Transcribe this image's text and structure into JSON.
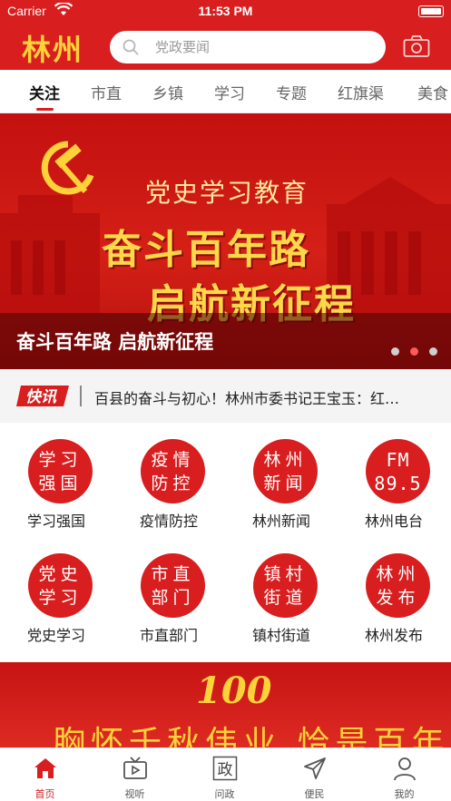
{
  "status": {
    "carrier": "Carrier",
    "time": "11:53 PM"
  },
  "header": {
    "logo_text": "林州",
    "search_placeholder": "党政要闻",
    "camera_icon": "camera-icon"
  },
  "tabs": [
    {
      "label": "关注",
      "active": true
    },
    {
      "label": "市直"
    },
    {
      "label": "乡镇"
    },
    {
      "label": "学习"
    },
    {
      "label": "专题"
    },
    {
      "label": "红旗渠"
    },
    {
      "label": "美食"
    }
  ],
  "banner": {
    "subtitle": "党史学习教育",
    "line1": "奋斗百年路",
    "line2": "启航新征程",
    "caption": "奋斗百年路 启航新征程",
    "active_slide": 2,
    "slide_count": 3
  },
  "news_flash": {
    "tag": "快讯",
    "text": "百县的奋斗与初心！林州市委书记王宝玉：红…"
  },
  "grid": [
    {
      "icon_line1": "学习",
      "icon_line2": "强国",
      "label": "学习强国"
    },
    {
      "icon_line1": "疫情",
      "icon_line2": "防控",
      "label": "疫情防控"
    },
    {
      "icon_line1": "林州",
      "icon_line2": "新闻",
      "label": "林州新闻"
    },
    {
      "icon_line1": "FM",
      "icon_line2": "89.5",
      "label": "林州电台"
    },
    {
      "icon_line1": "党史",
      "icon_line2": "学习",
      "label": "党史学习"
    },
    {
      "icon_line1": "市直",
      "icon_line2": "部门",
      "label": "市直部门"
    },
    {
      "icon_line1": "镇村",
      "icon_line2": "街道",
      "label": "镇村街道"
    },
    {
      "icon_line1": "林州",
      "icon_line2": "发布",
      "label": "林州发布"
    }
  ],
  "bottom_banner": {
    "badge": "100",
    "slogan": "胸怀千秋伟业 恰是百年风华"
  },
  "tabbar": [
    {
      "label": "首页",
      "icon": "home-icon",
      "active": true
    },
    {
      "label": "视听",
      "icon": "tv-icon"
    },
    {
      "label": "问政",
      "icon": "government-icon",
      "glyph": "政"
    },
    {
      "label": "便民",
      "icon": "send-icon"
    },
    {
      "label": "我的",
      "icon": "user-icon"
    }
  ],
  "colors": {
    "brand_red": "#d81e1e",
    "logo_gold": "#ffd23a"
  }
}
